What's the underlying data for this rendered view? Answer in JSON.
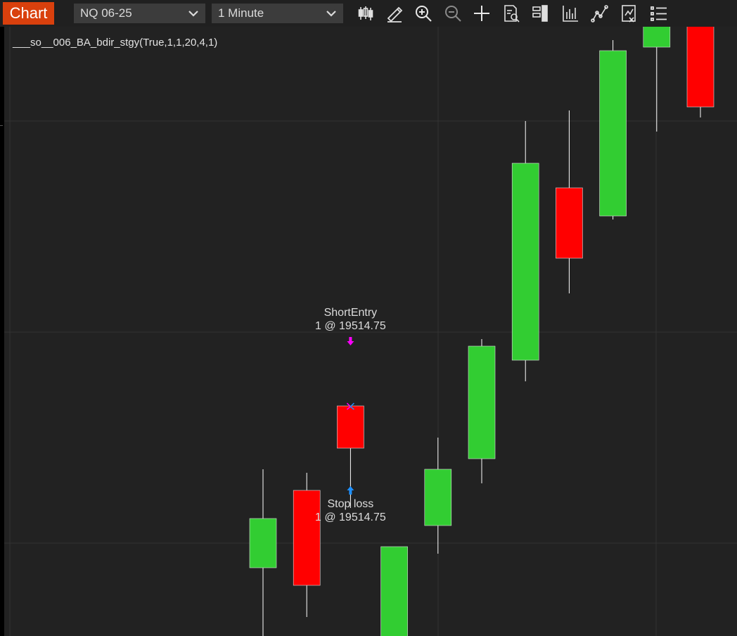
{
  "toolbar": {
    "chart_tab_label": "Chart",
    "instrument_value": "NQ 06-25",
    "interval_value": "1 Minute",
    "icons": [
      "bar-type-icon",
      "drawing-tool-icon",
      "zoom-in-icon",
      "zoom-out-icon",
      "crosshair-icon",
      "data-box-icon",
      "chart-trader-icon",
      "indicators-icon",
      "strategies-icon",
      "templates-icon",
      "properties-list-icon"
    ]
  },
  "chart": {
    "indicator_label": "___so__006_BA_bdir_stgy(True,1,1,20,4,1)",
    "short_entry_title": "ShortEntry",
    "short_entry_detail": "1 @ 19514.75",
    "stop_loss_title": "Stop loss",
    "stop_loss_detail": "1 @ 19514.75"
  },
  "colors": {
    "up": "#32cd32",
    "down": "#ff0000",
    "wick": "#ffffff",
    "background": "#222222",
    "short_entry_arrow": "#ff00ff",
    "stop_loss_arrow": "#1e90ff",
    "accent": "#d9400d"
  },
  "chart_data": {
    "type": "candlestick",
    "series": [
      {
        "direction": "up",
        "open": 19503.25,
        "high": 19510.25,
        "low": 19496.5,
        "close": 19506.75
      },
      {
        "direction": "down",
        "open": 19508.75,
        "high": 19510.0,
        "low": 19499.75,
        "close": 19502.0
      },
      {
        "direction": "down",
        "open": 19514.75,
        "high": 19511.0,
        "low": 19507.5,
        "close": 19511.75
      },
      {
        "direction": "up",
        "open": 19497.75,
        "high": 19504.25,
        "low": 19496.75,
        "close": 19504.75
      },
      {
        "direction": "up",
        "open": 19506.25,
        "high": 19512.5,
        "low": 19504.25,
        "close": 19510.25
      },
      {
        "direction": "up",
        "open": 19511.0,
        "high": 19519.5,
        "low": 19509.25,
        "close": 19519.0
      },
      {
        "direction": "up",
        "open": 19518.0,
        "high": 19535.0,
        "low": 19516.5,
        "close": 19532.0
      },
      {
        "direction": "down",
        "open": 19530.25,
        "high": 19535.75,
        "low": 19522.75,
        "close": 19525.25
      },
      {
        "direction": "up",
        "open": 19528.25,
        "high": 19540.75,
        "low": 19528.0,
        "close": 19540.0
      },
      {
        "direction": "up",
        "open": 19540.25,
        "high": 19541.5,
        "low": 19534.25,
        "close": 19542.0
      },
      {
        "direction": "down",
        "open": 19542.0,
        "high": 19544.5,
        "low": 19535.25,
        "close": 19536.0
      }
    ],
    "markers": [
      {
        "name": "ShortEntry",
        "qty": 1,
        "price": 19514.75,
        "bar_index": 2
      },
      {
        "name": "Stop loss",
        "qty": 1,
        "price": 19514.75,
        "bar_index": 2
      }
    ]
  }
}
